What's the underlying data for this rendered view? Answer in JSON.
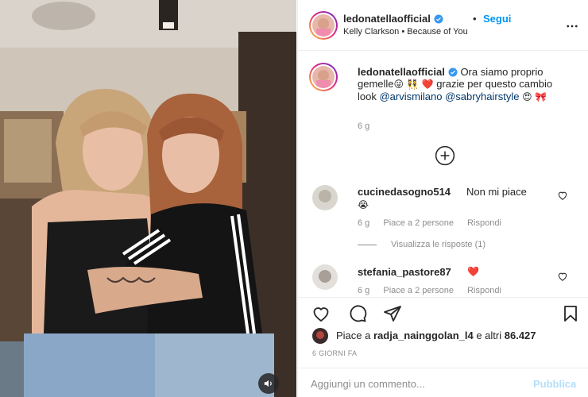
{
  "post": {
    "username": "ledonatella",
    "username_full": "ledonatellaofficial",
    "follow_label": "Segui",
    "separator": "•",
    "audio": "Kelly Clarkson • Because of You"
  },
  "caption": {
    "username": "ledonatellaofficial",
    "text_part1": "Ora siamo proprio gemelle",
    "emojis1": "😜 👯 ❤️",
    "text_part2": "grazie per questo cambio look",
    "tag1": "@arvismilano",
    "tag2": "@sabryhairstyle",
    "emojis2": "😍 🎀",
    "age": "6 g"
  },
  "comments": [
    {
      "username": "cucinedasogno514",
      "text": "Non mi piace",
      "emoji": "😭",
      "age": "6 g",
      "likes": "Piace a 2 persone",
      "reply": "Rispondi",
      "view_replies": "Visualizza le risposte (1)"
    },
    {
      "username": "stefania_pastore87",
      "text": "❤️",
      "age": "6 g",
      "likes": "Piace a 2 persone",
      "reply": "Rispondi"
    }
  ],
  "likes": {
    "prefix": "Piace a",
    "user": "radja_nainggolan_l4",
    "suffix": "e altri",
    "count": "86.427"
  },
  "date": "6 GIORNI FA",
  "add_comment": {
    "placeholder": "Aggiungi un commento...",
    "publish": "Pubblica"
  },
  "icons": {
    "verified": "verified-badge-icon",
    "more": "more-options-icon",
    "load_more": "plus-circle-icon",
    "like": "heart-icon",
    "comment": "comment-icon",
    "share": "share-icon",
    "save": "bookmark-icon",
    "sound": "speaker-icon"
  },
  "colors": {
    "link_blue": "#0095f6",
    "tag_blue": "#00376b",
    "muted": "#8e8e8e",
    "publish_disabled": "#b2dffc",
    "text": "#262626"
  }
}
